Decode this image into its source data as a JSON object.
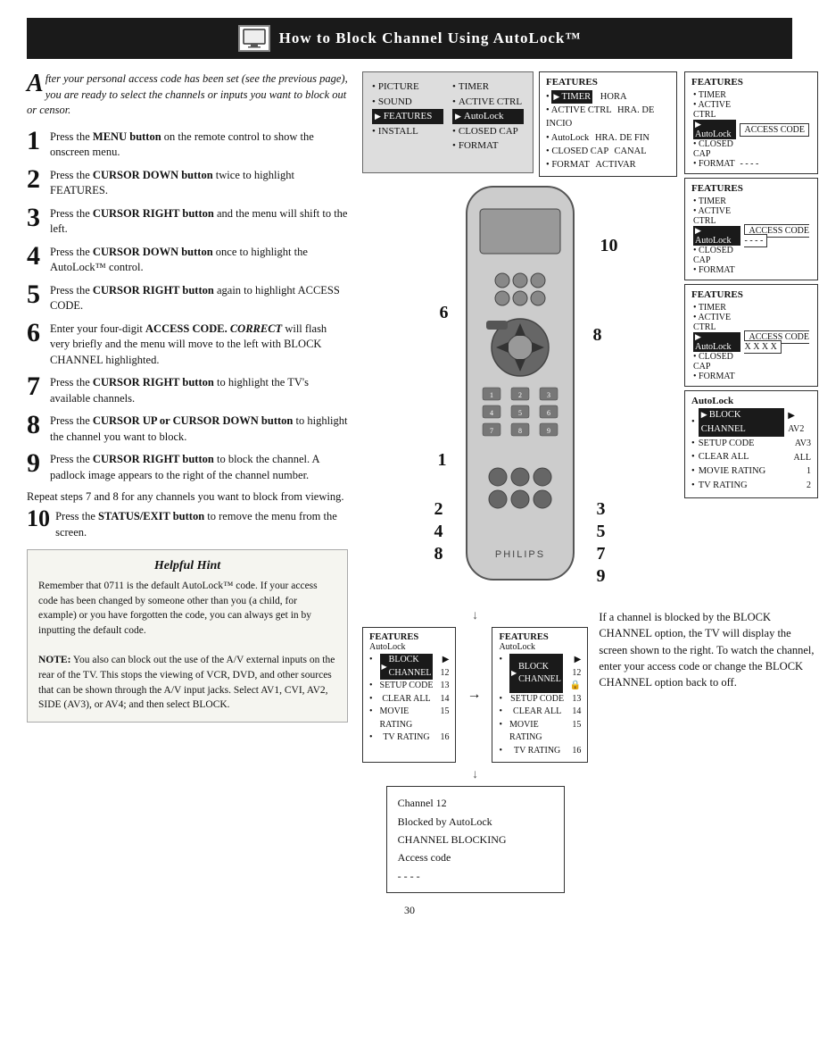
{
  "title": {
    "icon_alt": "TV icon",
    "text": "How to Block Channel Using AutoLock™"
  },
  "intro": {
    "drop_cap": "A",
    "text": "fter your personal access code has been set (see the previous page), you are ready to select the channels or inputs you want to block out or censor."
  },
  "steps": [
    {
      "num": "1",
      "text": "Press the <strong>MENU button</strong> on the remote control to show the onscreen menu."
    },
    {
      "num": "2",
      "text": "Press the <strong>CURSOR DOWN button</strong> twice to highlight FEATURES."
    },
    {
      "num": "3",
      "text": "Press the <strong>CURSOR RIGHT button</strong> and the menu will shift to the left."
    },
    {
      "num": "4",
      "text": "Press the <strong>CURSOR DOWN button</strong> once to highlight the AutoLock™ control."
    },
    {
      "num": "5",
      "text": "Press the <strong>CURSOR RIGHT button</strong> again to highlight ACCESS CODE."
    },
    {
      "num": "6",
      "text": "Enter your four-digit <strong>ACCESS CODE.</strong> <em>CORRECT</em> will flash very briefly and the menu will move to the left with BLOCK CHANNEL highlighted."
    },
    {
      "num": "7",
      "text": "Press the <strong>CURSOR RIGHT button</strong> to highlight the TV's available channels."
    },
    {
      "num": "8",
      "text": "Press the <strong>CURSOR UP or CURSOR DOWN button</strong> to highlight the channel you want to block."
    },
    {
      "num": "9",
      "text": "Press the <strong>CURSOR RIGHT button</strong> to block the channel. A padlock image appears to the right of the channel number."
    }
  ],
  "repeat_text": "Repeat steps 7 and 8 for any channels you want to block from viewing.",
  "step10": {
    "num": "10",
    "text": "Press the <strong>STATUS/EXIT button</strong> to remove the menu from the screen."
  },
  "hint": {
    "title": "Helpful Hint",
    "body": "Remember that 0711 is the default AutoLock™ code.  If your access code has been changed by someone other than you (a child, for example) or you have forgotten the code, you can always get in by inputting the default code.",
    "note": "<strong>NOTE:</strong>  You also can block out the use of the A/V external inputs on the rear of the TV.  This stops the viewing of VCR, DVD, and other sources that can be shown through the A/V input jacks. Select AV1, CVI, AV2, SIDE (AV3), or AV4; and then select BLOCK."
  },
  "menu_preview": {
    "col1_items": [
      "PICTURE",
      "SOUND",
      "FEATURES",
      "INSTALL"
    ],
    "col1_selected": "FEATURES",
    "col2_items": [
      "TIMER",
      "ACTIVE CTRL",
      "AutoLock",
      "CLOSED CAP",
      "FORMAT"
    ],
    "col2_selected": "AutoLock"
  },
  "features_panel_1": {
    "title": "FEATURES",
    "items": [
      "TIMER",
      "ACTIVE CTRL",
      "AutoLock",
      "CLOSED CAP",
      "FORMAT"
    ],
    "highlighted": "TIMER",
    "right_cols": [
      "HORA",
      "HRA. DE INCIO",
      "HRA. DE FIN",
      "CANAL",
      "ACTIVAR"
    ]
  },
  "features_panel_2": {
    "title": "FEATURES",
    "items": [
      "TIMER",
      "ACTIVE CTRL",
      "AutoLock",
      "CLOSED CAP",
      "FORMAT"
    ],
    "highlighted": "AutoLock",
    "access_code_label": "ACCESS CODE",
    "access_code_value": "- - - -"
  },
  "features_panel_3": {
    "title": "FEATURES",
    "items": [
      "TIMER",
      "ACTIVE CTRL",
      "AutoLock",
      "CLOSED CAP",
      "FORMAT"
    ],
    "highlighted": "AutoLock",
    "access_code_label": "ACCESS CODE",
    "access_code_value": "- - - -"
  },
  "features_panel_4": {
    "title": "FEATURES",
    "items": [
      "TIMER",
      "ACTIVE CTRL",
      "AutoLock",
      "CLOSED CAP",
      "FORMAT"
    ],
    "highlighted": "AutoLock",
    "access_code_label": "ACCESS CODE",
    "access_code_value": "X X X X"
  },
  "autolock_panel": {
    "title": "AutoLock",
    "items": [
      "BLOCK CHANNEL",
      "SETUP CODE",
      "CLEAR ALL",
      "MOVIE RATING",
      "TV RATING"
    ],
    "highlighted": "BLOCK CHANNEL",
    "right_values": [
      "▶ AV2",
      "AV3",
      "ALL",
      "1",
      "2"
    ]
  },
  "channel_panel_left": {
    "title": "FEATURES",
    "subtitle": "AutoLock",
    "items": [
      "BLOCK CHANNEL",
      "SETUP CODE",
      "CLEAR ALL",
      "MOVIE RATING",
      "TV RATING"
    ],
    "highlighted": "BLOCK CHANNEL",
    "values": [
      "▶ 12",
      "13",
      "14",
      "15",
      "16"
    ]
  },
  "channel_panel_right": {
    "title": "FEATURES",
    "subtitle": "AutoLock",
    "items": [
      "BLOCK CHANNEL",
      "SETUP CODE",
      "CLEAR ALL",
      "MOVIE RATING",
      "TV RATING"
    ],
    "highlighted": "BLOCK CHANNEL",
    "values": [
      "▶ 12 🔒",
      "13",
      "14",
      "15",
      "16"
    ]
  },
  "channel_blocked": {
    "line1": "Channel 12",
    "line2": "Blocked by AutoLock",
    "line3": "CHANNEL BLOCKING",
    "line4": "Access code",
    "line5": "- - - -"
  },
  "blocked_description": "If a channel is blocked by the BLOCK CHANNEL option, the TV will display the screen shown to the right. To watch the channel, enter your access code or change the BLOCK CHANNEL option back to off.",
  "page_number": "30",
  "step_labels_on_remote": {
    "label_6": "6",
    "label_8": "8",
    "label_10": "10",
    "label_1": "1",
    "label_2": "2",
    "label_4": "4",
    "label_8b": "8",
    "label_3": "3",
    "label_5": "5",
    "label_7": "7",
    "label_9": "9"
  }
}
